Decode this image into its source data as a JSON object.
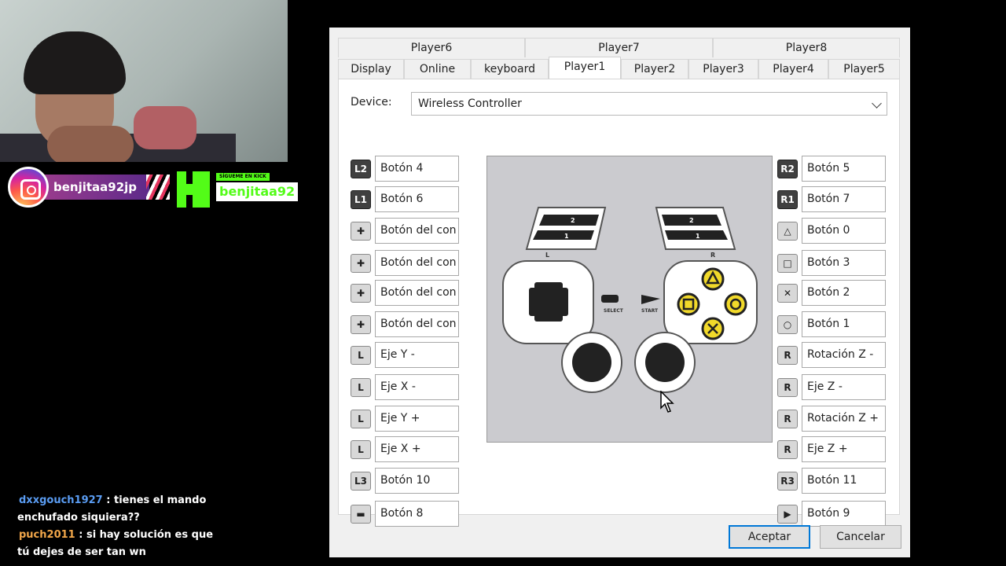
{
  "stream": {
    "instagram_handle": "benjitaa92jp",
    "kick_follow": "SÍGUEME EN KICK",
    "kick_handle": "benjitaa92",
    "chat": [
      {
        "user": "dxxgouch1927",
        "text": ": tienes el mando enchufado siquiera??"
      },
      {
        "user": "puch2011",
        "text": ": si hay solución es que tú dejes de ser tan wn"
      }
    ]
  },
  "dialog": {
    "tabs_row1": [
      "Player6",
      "Player7",
      "Player8"
    ],
    "tabs_row2": [
      "Display",
      "Online",
      "keyboard",
      "Player1",
      "Player2",
      "Player3",
      "Player4",
      "Player5"
    ],
    "active_tab": "Player1",
    "device_label": "Device:",
    "device_value": "Wireless Controller",
    "left_mappings": [
      {
        "icon": "l2-icon",
        "glyph": "L2",
        "label": "Botón 4"
      },
      {
        "icon": "l1-icon",
        "glyph": "L1",
        "label": "Botón 6"
      },
      {
        "icon": "dpad-up-icon",
        "glyph": "✚",
        "label": "Botón del con"
      },
      {
        "icon": "dpad-left-icon",
        "glyph": "✚",
        "label": "Botón del con"
      },
      {
        "icon": "dpad-down-icon",
        "glyph": "✚",
        "label": "Botón del con"
      },
      {
        "icon": "dpad-right-icon",
        "glyph": "✚",
        "label": "Botón del con"
      },
      {
        "icon": "left-stick-up-icon",
        "glyph": "L",
        "label": "Eje Y -"
      },
      {
        "icon": "left-stick-left-icon",
        "glyph": "L",
        "label": "Eje X -"
      },
      {
        "icon": "left-stick-down-icon",
        "glyph": "L",
        "label": "Eje Y +"
      },
      {
        "icon": "left-stick-right-icon",
        "glyph": "L",
        "label": "Eje X +"
      },
      {
        "icon": "l3-icon",
        "glyph": "L3",
        "label": "Botón 10"
      },
      {
        "icon": "select-icon",
        "glyph": "▬",
        "label": "Botón 8"
      }
    ],
    "right_mappings": [
      {
        "icon": "r2-icon",
        "glyph": "R2",
        "label": "Botón 5"
      },
      {
        "icon": "r1-icon",
        "glyph": "R1",
        "label": "Botón 7"
      },
      {
        "icon": "triangle-icon",
        "glyph": "△",
        "label": "Botón 0"
      },
      {
        "icon": "square-icon",
        "glyph": "□",
        "label": "Botón 3"
      },
      {
        "icon": "cross-icon",
        "glyph": "✕",
        "label": "Botón 2"
      },
      {
        "icon": "circle-icon",
        "glyph": "○",
        "label": "Botón 1"
      },
      {
        "icon": "right-stick-up-icon",
        "glyph": "R",
        "label": "Rotación Z -"
      },
      {
        "icon": "right-stick-left-icon",
        "glyph": "R",
        "label": "Eje Z -"
      },
      {
        "icon": "right-stick-down-icon",
        "glyph": "R",
        "label": "Rotación Z +"
      },
      {
        "icon": "right-stick-right-icon",
        "glyph": "R",
        "label": "Eje Z +"
      },
      {
        "icon": "r3-icon",
        "glyph": "R3",
        "label": "Botón 11"
      },
      {
        "icon": "start-icon",
        "glyph": "▶",
        "label": "Botón 9"
      }
    ],
    "controller_labels": {
      "select": "SELECT",
      "start": "START",
      "l": "L",
      "r": "R",
      "one": "1",
      "two": "2"
    },
    "ok_label": "Aceptar",
    "cancel_label": "Cancelar"
  }
}
